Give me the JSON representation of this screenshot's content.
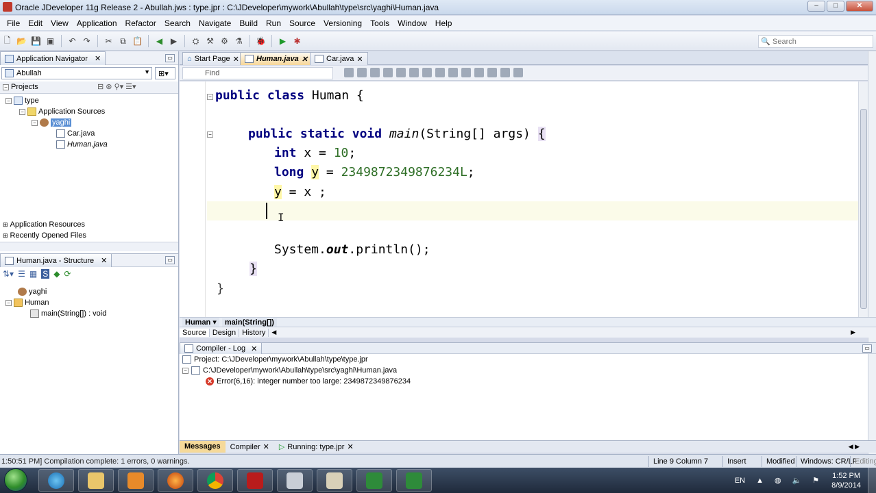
{
  "window": {
    "title": "Oracle JDeveloper 11g Release 2 - Abullah.jws : type.jpr : C:\\JDeveloper\\mywork\\Abullah\\type\\src\\yaghi\\Human.java"
  },
  "menu": [
    "File",
    "Edit",
    "View",
    "Application",
    "Refactor",
    "Search",
    "Navigate",
    "Build",
    "Run",
    "Source",
    "Versioning",
    "Tools",
    "Window",
    "Help"
  ],
  "toolbar": {
    "search_placeholder": "Search"
  },
  "navigator": {
    "tab_label": "Application Navigator",
    "app_combo": "Abullah",
    "projects_label": "Projects",
    "tree": {
      "project": "type",
      "app_sources": "Application Sources",
      "package": "yaghi",
      "files": [
        "Car.java",
        "Human.java"
      ]
    },
    "app_resources": "Application Resources",
    "recent_files": "Recently Opened Files"
  },
  "structure": {
    "tab_label": "Human.java - Structure",
    "tree": {
      "package": "yaghi",
      "class": "Human",
      "method": "main(String[]) : void"
    }
  },
  "editor": {
    "tabs": [
      "Start Page",
      "Human.java",
      "Car.java"
    ],
    "active_tab": "Human.java",
    "find_placeholder": "Find",
    "breadcrumb": [
      "Human",
      "main(String[])"
    ],
    "source_tabs": [
      "Source",
      "Design",
      "History"
    ],
    "code": {
      "class_decl": [
        "public",
        "class",
        "Human {"
      ],
      "main_decl": [
        "public",
        "static",
        "void",
        "main",
        "(String[] args) ",
        "{"
      ],
      "int_decl": [
        "int",
        " x = ",
        "10",
        ";"
      ],
      "long_decl": [
        "long",
        "y",
        " = ",
        "2349872349876234L",
        ";"
      ],
      "assign": [
        "y",
        " = x ;"
      ],
      "println": [
        "System.",
        "out",
        ".println();"
      ],
      "close_method": "}",
      "close_class": "}"
    }
  },
  "compiler_log": {
    "tab_label": "Compiler - Log",
    "project_line": "Project: C:\\JDeveloper\\mywork\\Abullah\\type\\type.jpr",
    "file_line": "C:\\JDeveloper\\mywork\\Abullah\\type\\src\\yaghi\\Human.java",
    "error_line": "Error(6,16):  integer number too large: 2349872349876234",
    "bottom_tabs": [
      "Messages",
      "Compiler",
      "Running: type.jpr"
    ]
  },
  "status": {
    "message": "1:50:51 PM] Compilation complete: 1 errors, 0 warnings.",
    "position": "Line 9 Column 7",
    "mode": "Insert",
    "modified": "Modified",
    "line_ending": "Windows: CR/LF",
    "encoding": "Editing"
  },
  "taskbar": {
    "language": "EN",
    "time": "1:52 PM",
    "date": "8/9/2014"
  },
  "colors": {
    "keyword": "#000080",
    "number": "#2f6f27",
    "error": "#d63a2a",
    "active_tab": "#f6d699"
  }
}
